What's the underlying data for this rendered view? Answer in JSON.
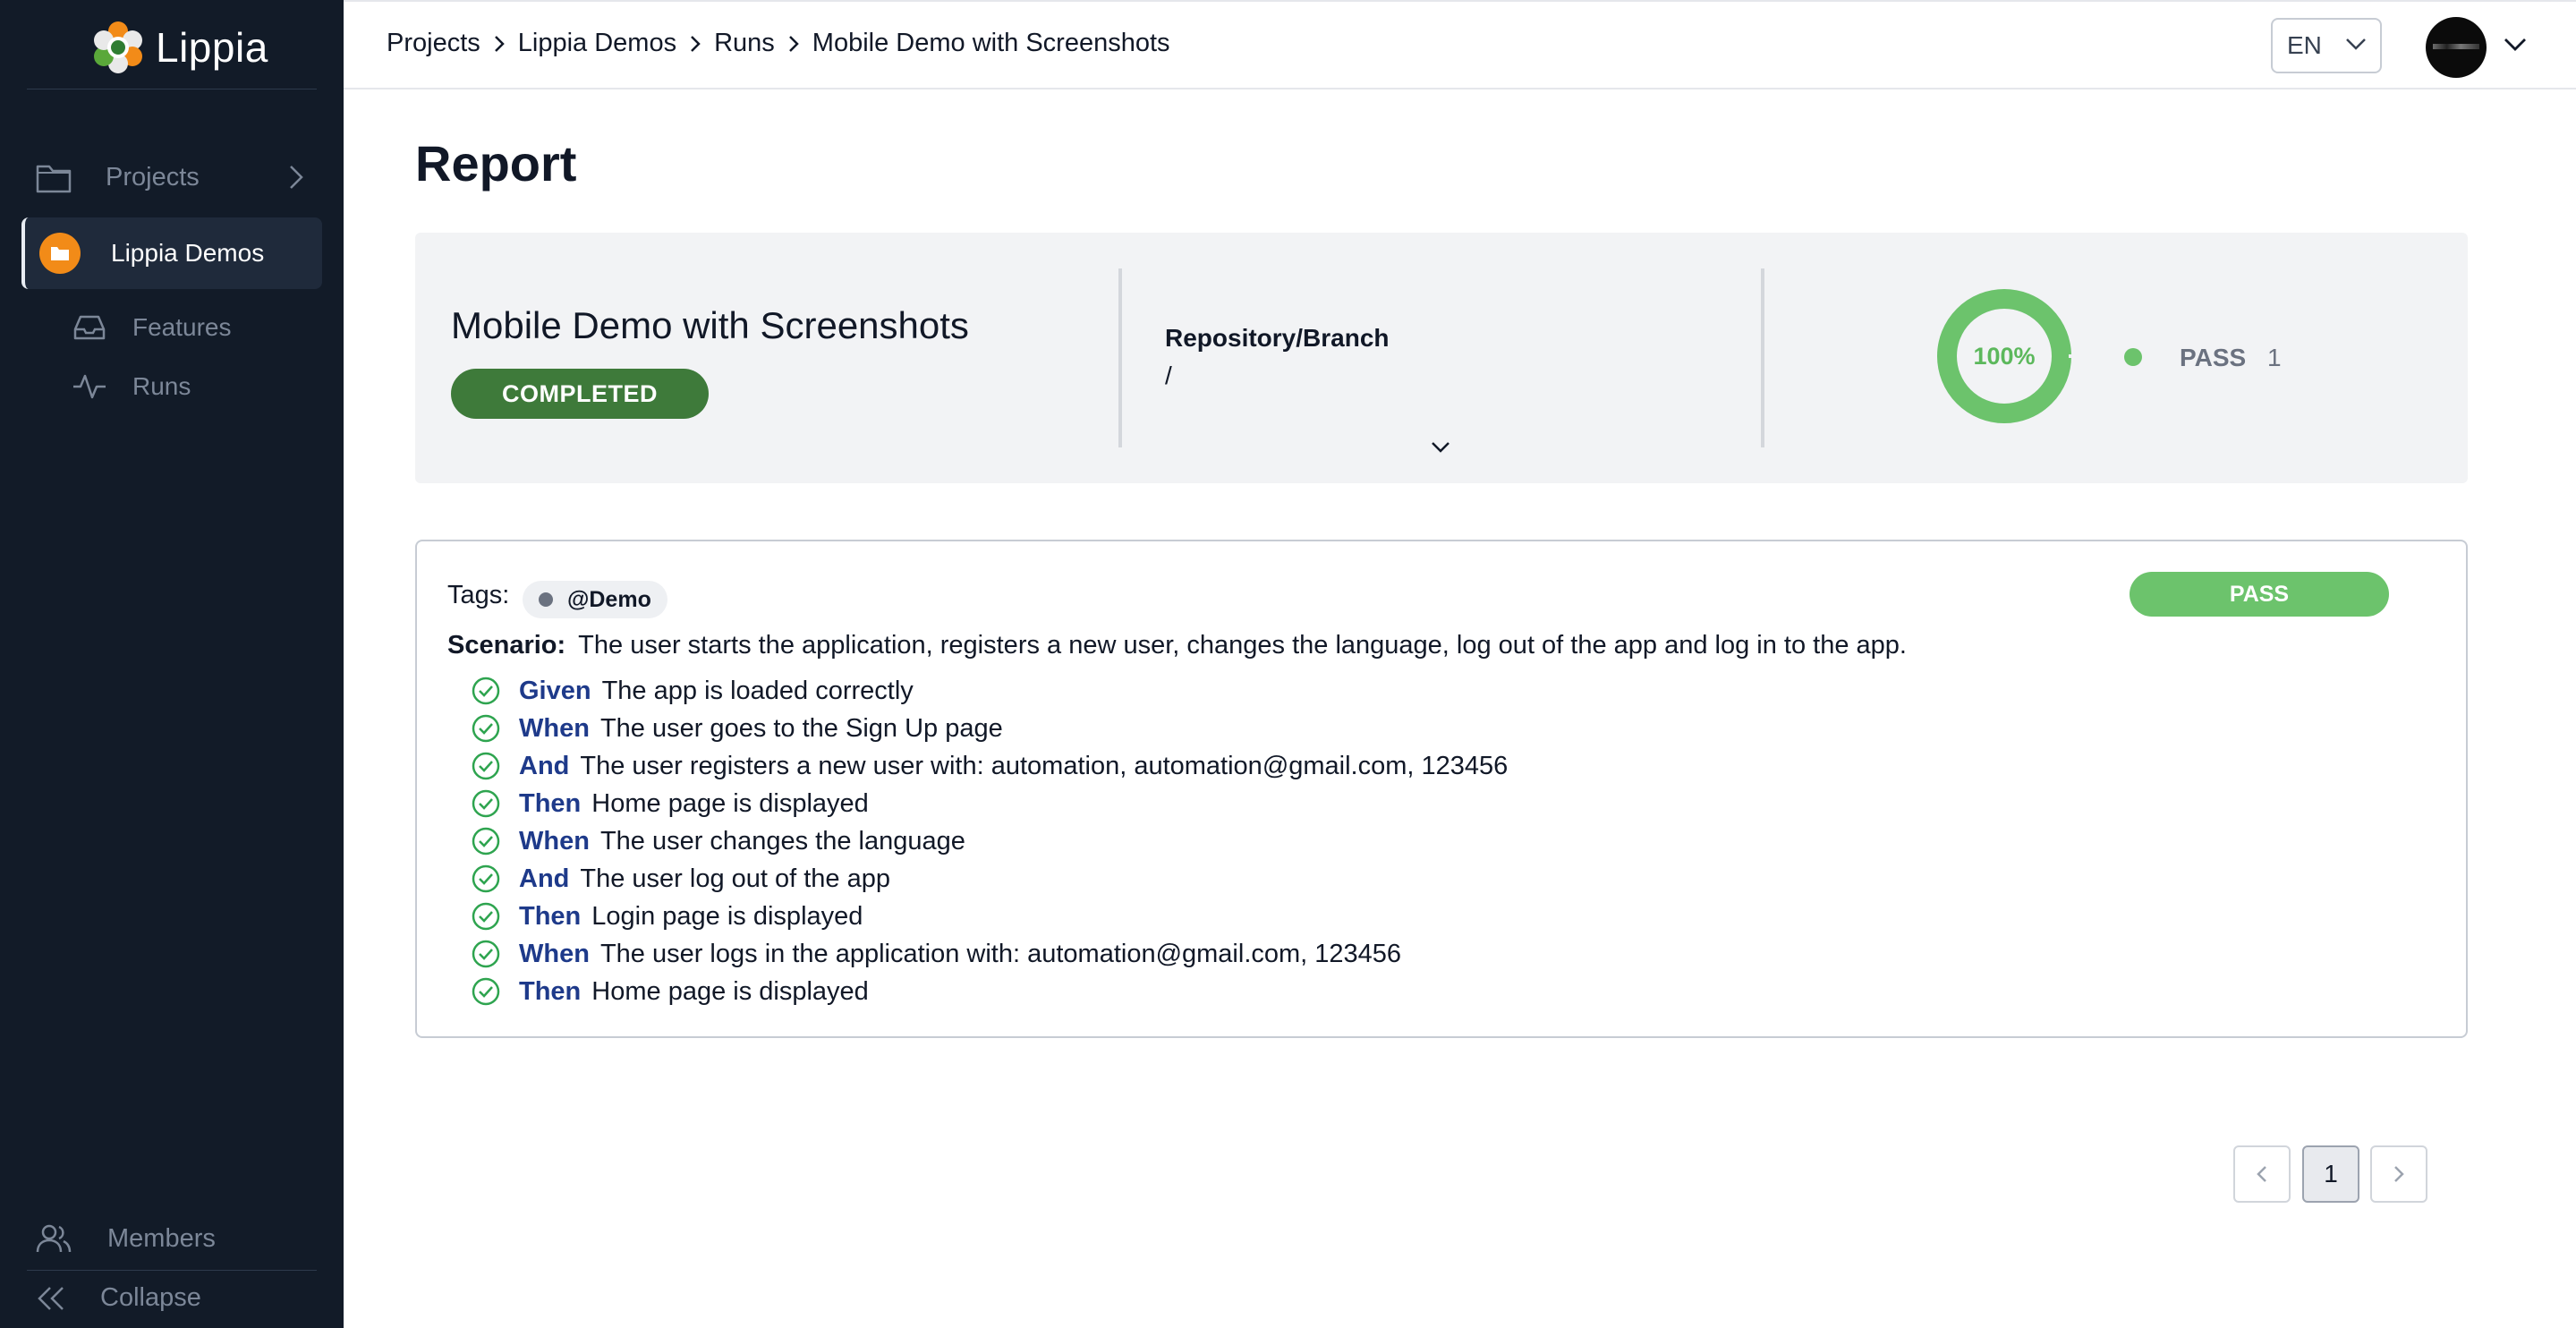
{
  "app": {
    "name": "Lippia"
  },
  "sidebar": {
    "projects_label": "Projects",
    "active_project": "Lippia Demos",
    "features_label": "Features",
    "runs_label": "Runs",
    "members_label": "Members",
    "collapse_label": "Collapse"
  },
  "breadcrumb": [
    "Projects",
    "Lippia Demos",
    "Runs",
    "Mobile Demo with Screenshots"
  ],
  "header": {
    "language": "EN"
  },
  "page": {
    "title": "Report"
  },
  "summary": {
    "run_name": "Mobile Demo with Screenshots",
    "status": "COMPLETED",
    "repo_label": "Repository/Branch",
    "repo_value": "/",
    "pass_percent_label": "100%",
    "pass_fraction": 1.0,
    "legend_label": "PASS",
    "legend_count": "1"
  },
  "scenario": {
    "tags_label": "Tags:",
    "tag": "@Demo",
    "result": "PASS",
    "scenario_kw": "Scenario:",
    "scenario_text": "The user starts the application, registers a new user, changes the language, log out of the app and log in to the app.",
    "steps": [
      {
        "kw": "Given",
        "text": "The app is loaded correctly"
      },
      {
        "kw": "When",
        "text": "The user goes to the Sign Up page"
      },
      {
        "kw": "And",
        "text": "The user registers a new user with: automation, automation@gmail.com, 123456"
      },
      {
        "kw": "Then",
        "text": "Home page is displayed"
      },
      {
        "kw": "When",
        "text": "The user changes the language"
      },
      {
        "kw": "And",
        "text": "The user log out of the app"
      },
      {
        "kw": "Then",
        "text": "Login page is displayed"
      },
      {
        "kw": "When",
        "text": "The user logs in the application with: automation@gmail.com, 123456"
      },
      {
        "kw": "Then",
        "text": "Home page is displayed"
      }
    ]
  },
  "pagination": {
    "current": "1"
  },
  "colors": {
    "sidebar_bg": "#121b28",
    "pass_green": "#6cc36c",
    "completed_green": "#3e7a3a",
    "keyword_blue": "#1e3a8a",
    "project_orange": "#f28b18"
  }
}
